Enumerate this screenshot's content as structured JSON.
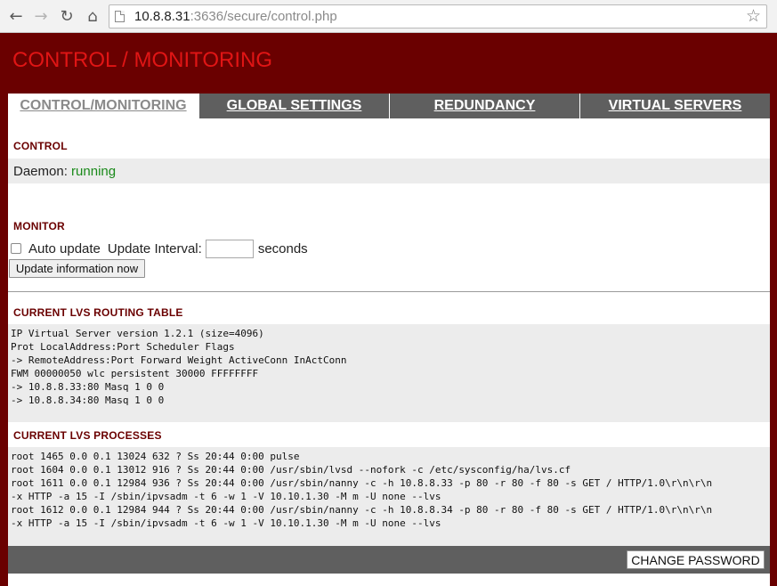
{
  "browser": {
    "url_host": "10.8.8.31",
    "url_rest": ":3636/secure/control.php",
    "back_icon": "arrow-left-icon",
    "forward_icon": "arrow-right-icon",
    "reload_icon": "reload-icon",
    "home_icon": "home-icon",
    "bookmark_icon": "star-icon"
  },
  "app": {
    "title": "CONTROL / MONITORING",
    "accent_color": "#6a0000",
    "title_color": "#e01515"
  },
  "tabs": [
    {
      "label": "CONTROL/MONITORING",
      "active": true
    },
    {
      "label": "GLOBAL SETTINGS",
      "active": false
    },
    {
      "label": "REDUNDANCY",
      "active": false
    },
    {
      "label": "VIRTUAL SERVERS",
      "active": false
    }
  ],
  "control": {
    "heading": "CONTROL",
    "daemon_label": "Daemon:",
    "daemon_status": "running",
    "status_color": "#1a8a1a"
  },
  "monitor": {
    "heading": "MONITOR",
    "auto_update_label": "Auto update",
    "auto_update_checked": false,
    "interval_label": "Update Interval:",
    "interval_value": "",
    "seconds_label": "seconds",
    "update_button": "Update information now"
  },
  "routing": {
    "heading": "CURRENT LVS ROUTING TABLE",
    "lines": [
      "IP Virtual Server version 1.2.1 (size=4096)",
      "Prot LocalAddress:Port Scheduler Flags",
      "-> RemoteAddress:Port Forward Weight ActiveConn InActConn",
      "FWM 00000050 wlc persistent 30000 FFFFFFFF",
      "-> 10.8.8.33:80 Masq 1 0 0",
      "-> 10.8.8.34:80 Masq 1 0 0"
    ]
  },
  "processes": {
    "heading": "CURRENT LVS PROCESSES",
    "lines": [
      "root 1465 0.0 0.1 13024 632 ? Ss 20:44 0:00 pulse",
      "root 1604 0.0 0.1 13012 916 ? Ss 20:44 0:00 /usr/sbin/lvsd --nofork -c /etc/sysconfig/ha/lvs.cf",
      "root 1611 0.0 0.1 12984 936 ? Ss 20:44 0:00 /usr/sbin/nanny -c -h 10.8.8.33 -p 80 -r 80 -f 80 -s GET / HTTP/1.0\\r\\n\\r\\n",
      "-x HTTP -a 15 -I /sbin/ipvsadm -t 6 -w 1 -V 10.10.1.30 -M m -U none --lvs",
      "root 1612 0.0 0.1 12984 944 ? Ss 20:44 0:00 /usr/sbin/nanny -c -h 10.8.8.34 -p 80 -r 80 -f 80 -s GET / HTTP/1.0\\r\\n\\r\\n",
      "-x HTTP -a 15 -I /sbin/ipvsadm -t 6 -w 1 -V 10.10.1.30 -M m -U none --lvs"
    ]
  },
  "footer": {
    "change_password_button": "CHANGE PASSWORD"
  }
}
